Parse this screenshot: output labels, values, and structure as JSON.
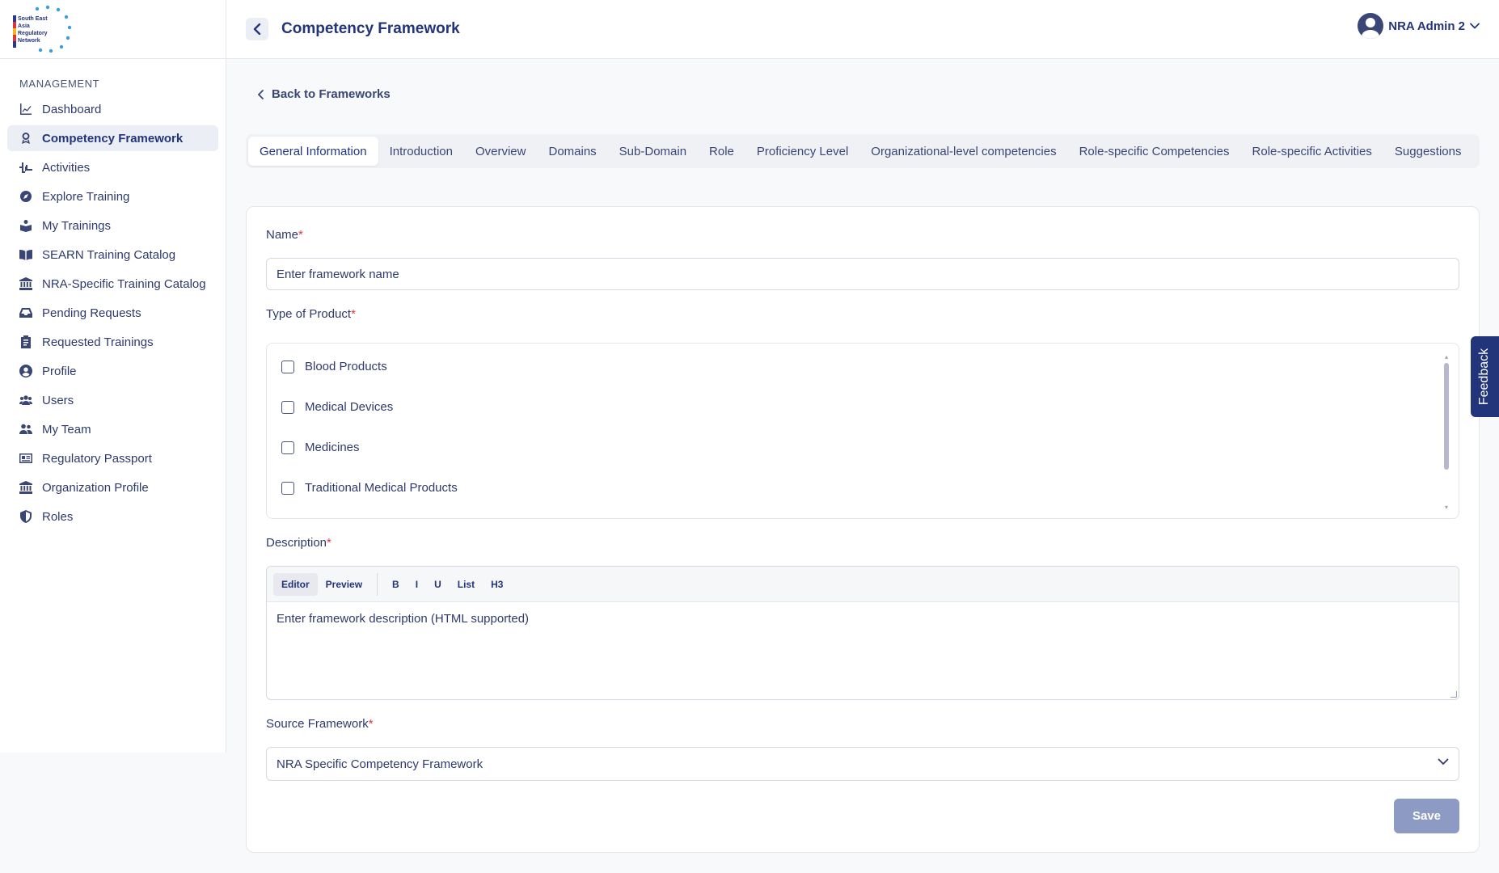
{
  "logo": {
    "lines": [
      "South East",
      "Asia",
      "Regulatory",
      "Network"
    ]
  },
  "sidebar": {
    "section_title": "MANAGEMENT",
    "items": [
      {
        "label": "Dashboard",
        "icon": "chart-line-icon"
      },
      {
        "label": "Competency Framework",
        "icon": "award-icon",
        "active": true
      },
      {
        "label": "Activities",
        "icon": "activity-icon"
      },
      {
        "label": "Explore Training",
        "icon": "compass-icon"
      },
      {
        "label": "My Trainings",
        "icon": "reader-icon"
      },
      {
        "label": "SEARN Training Catalog",
        "icon": "book-open-icon"
      },
      {
        "label": "NRA-Specific Training Catalog",
        "icon": "institution-icon"
      },
      {
        "label": "Pending Requests",
        "icon": "inbox-icon"
      },
      {
        "label": "Requested Trainings",
        "icon": "clipboard-icon"
      },
      {
        "label": "Profile",
        "icon": "user-circle-icon"
      },
      {
        "label": "Users",
        "icon": "users-icon"
      },
      {
        "label": "My Team",
        "icon": "team-icon"
      },
      {
        "label": "Regulatory Passport",
        "icon": "id-card-icon"
      },
      {
        "label": "Organization Profile",
        "icon": "institution-icon"
      },
      {
        "label": "Roles",
        "icon": "shield-icon"
      }
    ]
  },
  "header": {
    "title": "Competency Framework",
    "user_name": "NRA Admin 2"
  },
  "back_link": "Back to Frameworks",
  "tabs": [
    {
      "label": "General Information",
      "active": true
    },
    {
      "label": "Introduction"
    },
    {
      "label": "Overview"
    },
    {
      "label": "Domains"
    },
    {
      "label": "Sub-Domain"
    },
    {
      "label": "Role"
    },
    {
      "label": "Proficiency Level"
    },
    {
      "label": "Organizational-level competencies"
    },
    {
      "label": "Role-specific Competencies"
    },
    {
      "label": "Role-specific Activities"
    },
    {
      "label": "Suggestions"
    }
  ],
  "form": {
    "name_label": "Name",
    "name_placeholder": "Enter framework name",
    "product_label": "Type of Product",
    "products": [
      "Blood Products",
      "Medical Devices",
      "Medicines",
      "Traditional Medical Products"
    ],
    "description_label": "Description",
    "toolbar": {
      "editor": "Editor",
      "preview": "Preview",
      "bold": "B",
      "italic": "I",
      "underline": "U",
      "list": "List",
      "h3": "H3"
    },
    "description_placeholder": "Enter framework description (HTML supported)",
    "source_label": "Source Framework",
    "source_value": "NRA Specific Competency Framework",
    "required_mark": "*",
    "save_label": "Save"
  },
  "feedback_label": "Feedback",
  "colors": {
    "brand": "#23357a",
    "save_disabled": "#8c9ac4",
    "required": "#d9363e"
  }
}
